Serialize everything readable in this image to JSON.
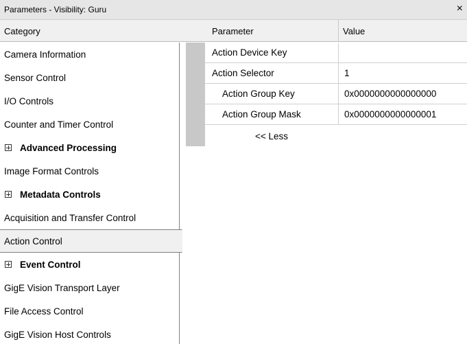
{
  "window": {
    "title": "Parameters - Visibility: Guru",
    "close_glyph": "×"
  },
  "headers": {
    "category": "Category",
    "parameter": "Parameter",
    "value": "Value"
  },
  "categories": [
    {
      "label": "Camera Information",
      "group": false,
      "selected": false
    },
    {
      "label": "Sensor Control",
      "group": false,
      "selected": false
    },
    {
      "label": "I/O Controls",
      "group": false,
      "selected": false
    },
    {
      "label": "Counter and Timer Control",
      "group": false,
      "selected": false
    },
    {
      "label": "Advanced Processing",
      "group": true,
      "selected": false
    },
    {
      "label": "Image Format Controls",
      "group": false,
      "selected": false
    },
    {
      "label": "Metadata Controls",
      "group": true,
      "selected": false
    },
    {
      "label": "Acquisition and Transfer Control",
      "group": false,
      "selected": false
    },
    {
      "label": "Action Control",
      "group": false,
      "selected": true
    },
    {
      "label": "Event Control",
      "group": true,
      "selected": false
    },
    {
      "label": "GigE Vision Transport Layer",
      "group": false,
      "selected": false
    },
    {
      "label": "File Access Control",
      "group": false,
      "selected": false
    },
    {
      "label": "GigE Vision Host Controls",
      "group": false,
      "selected": false
    }
  ],
  "parameters": [
    {
      "name": "Action Device Key",
      "value": "",
      "indent": 0
    },
    {
      "name": "Action Selector",
      "value": "1",
      "indent": 0
    },
    {
      "name": "Action Group Key",
      "value": "0x0000000000000000",
      "indent": 1
    },
    {
      "name": "Action Group Mask",
      "value": "0x0000000000000001",
      "indent": 1
    }
  ],
  "less_link": "<< Less",
  "colors": {
    "titlebar_bg": "#e6e6e6",
    "selected_bg": "#f0f0f0",
    "gutter": "#c8c8c8"
  }
}
